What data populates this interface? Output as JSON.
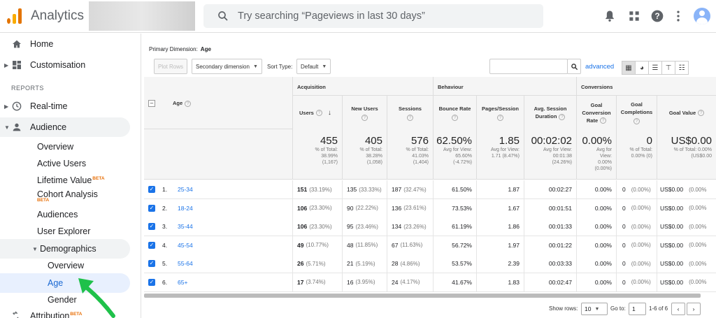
{
  "app": {
    "title": "Analytics"
  },
  "search": {
    "placeholder": "Try searching “Pageviews in last 30 days”"
  },
  "topbar_icons": [
    "bell-icon",
    "apps-grid-icon",
    "help-icon",
    "more-vert-icon",
    "avatar"
  ],
  "sidebar": {
    "home": "Home",
    "customisation": "Customisation",
    "reports_header": "REPORTS",
    "realtime": "Real-time",
    "audience": "Audience",
    "audience_items": [
      "Overview",
      "Active Users",
      "Lifetime Value",
      "Cohort Analysis",
      "Audiences",
      "User Explorer"
    ],
    "beta": "BETA",
    "demographics": "Demographics",
    "demo_items": [
      "Overview",
      "Age",
      "Gender"
    ],
    "attribution": "Attribution"
  },
  "toolbar": {
    "primary_dimension_label": "Primary Dimension:",
    "primary_dimension_value": "Age",
    "plot_rows": "Plot Rows",
    "secondary_dimension": "Secondary dimension",
    "sort_type_label": "Sort Type:",
    "sort_type_value": "Default",
    "advanced": "advanced"
  },
  "table": {
    "groups": {
      "acquisition": "Acquisition",
      "behaviour": "Behaviour",
      "conversions": "Conversions"
    },
    "columns": {
      "age": "Age",
      "users": "Users",
      "new_users": "New Users",
      "sessions": "Sessions",
      "bounce_rate": "Bounce Rate",
      "pages_session": "Pages/Session",
      "avg_session_1": "Avg. Session",
      "avg_session_2": "Duration",
      "goal_conv_1": "Goal",
      "goal_conv_2": "Conversion",
      "goal_conv_3": "Rate",
      "goal_comp_1": "Goal",
      "goal_comp_2": "Completions",
      "goal_value": "Goal Value"
    },
    "totals": {
      "users": {
        "big": "455",
        "l1": "% of Total:",
        "l2": "38.99%",
        "l3": "(1,167)"
      },
      "new_users": {
        "big": "405",
        "l1": "% of Total:",
        "l2": "38.28%",
        "l3": "(1,058)"
      },
      "sessions": {
        "big": "576",
        "l1": "% of Total:",
        "l2": "41.03%",
        "l3": "(1,404)"
      },
      "bounce_rate": {
        "big": "62.50%",
        "l1": "Avg for View:",
        "l2": "65.60%",
        "l3": "(-4.72%)"
      },
      "pages_session": {
        "big": "1.85",
        "l1": "Avg for View:",
        "l2": "1.71 (8.47%)",
        "l3": ""
      },
      "avg_duration": {
        "big": "00:02:02",
        "l1": "Avg for View:",
        "l2": "00:01:38",
        "l3": "(24.26%)"
      },
      "goal_conv": {
        "big": "0.00%",
        "l1": "Avg for",
        "l2": "View:",
        "l3": "0.00%",
        "l4": "(0.00%)"
      },
      "goal_comp": {
        "big": "0",
        "l1": "% of Total:",
        "l2": "0.00% (0)",
        "l3": ""
      },
      "goal_value": {
        "big": "US$0.00",
        "l1": "% of Total: 0.00%",
        "l2": "(US$0.00",
        "l3": ""
      }
    },
    "rows": [
      {
        "idx": "1.",
        "age": "25-34",
        "users": "151",
        "users_pct": "(33.19%)",
        "new_users": "135",
        "new_pct": "(33.33%)",
        "sessions": "187",
        "sess_pct": "(32.47%)",
        "bounce": "61.50%",
        "pages": "1.87",
        "duration": "00:02:27",
        "conv": "0.00%",
        "comp": "0",
        "comp_pct": "(0.00%)",
        "value": "US$0.00",
        "value_pct": "(0.00%"
      },
      {
        "idx": "2.",
        "age": "18-24",
        "users": "106",
        "users_pct": "(23.30%)",
        "new_users": "90",
        "new_pct": "(22.22%)",
        "sessions": "136",
        "sess_pct": "(23.61%)",
        "bounce": "73.53%",
        "pages": "1.67",
        "duration": "00:01:51",
        "conv": "0.00%",
        "comp": "0",
        "comp_pct": "(0.00%)",
        "value": "US$0.00",
        "value_pct": "(0.00%"
      },
      {
        "idx": "3.",
        "age": "35-44",
        "users": "106",
        "users_pct": "(23.30%)",
        "new_users": "95",
        "new_pct": "(23.46%)",
        "sessions": "134",
        "sess_pct": "(23.26%)",
        "bounce": "61.19%",
        "pages": "1.86",
        "duration": "00:01:33",
        "conv": "0.00%",
        "comp": "0",
        "comp_pct": "(0.00%)",
        "value": "US$0.00",
        "value_pct": "(0.00%"
      },
      {
        "idx": "4.",
        "age": "45-54",
        "users": "49",
        "users_pct": "(10.77%)",
        "new_users": "48",
        "new_pct": "(11.85%)",
        "sessions": "67",
        "sess_pct": "(11.63%)",
        "bounce": "56.72%",
        "pages": "1.97",
        "duration": "00:01:22",
        "conv": "0.00%",
        "comp": "0",
        "comp_pct": "(0.00%)",
        "value": "US$0.00",
        "value_pct": "(0.00%"
      },
      {
        "idx": "5.",
        "age": "55-64",
        "users": "26",
        "users_pct": "(5.71%)",
        "new_users": "21",
        "new_pct": "(5.19%)",
        "sessions": "28",
        "sess_pct": "(4.86%)",
        "bounce": "53.57%",
        "pages": "2.39",
        "duration": "00:03:33",
        "conv": "0.00%",
        "comp": "0",
        "comp_pct": "(0.00%)",
        "value": "US$0.00",
        "value_pct": "(0.00%"
      },
      {
        "idx": "6.",
        "age": "65+",
        "users": "17",
        "users_pct": "(3.74%)",
        "new_users": "16",
        "new_pct": "(3.95%)",
        "sessions": "24",
        "sess_pct": "(4.17%)",
        "bounce": "41.67%",
        "pages": "1.83",
        "duration": "00:02:47",
        "conv": "0.00%",
        "comp": "0",
        "comp_pct": "(0.00%)",
        "value": "US$0.00",
        "value_pct": "(0.00%"
      }
    ]
  },
  "pager": {
    "show_rows_label": "Show rows:",
    "show_rows_value": "10",
    "goto_label": "Go to:",
    "goto_value": "1",
    "range": "1-6 of 6"
  },
  "colors": {
    "accent": "#1a73e8",
    "beta": "#e8710a",
    "arrow": "#1fc14a"
  }
}
